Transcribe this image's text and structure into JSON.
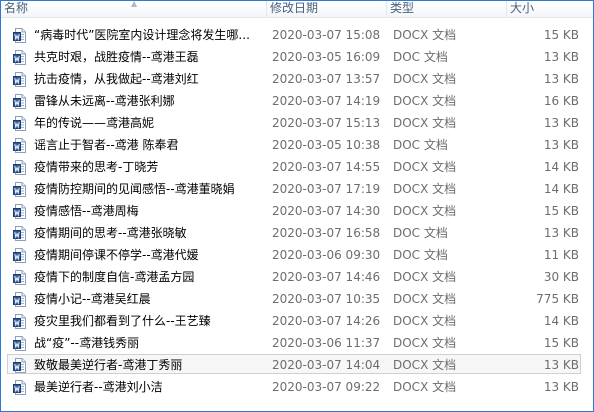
{
  "header": {
    "name": "名称",
    "date": "修改日期",
    "type": "类型",
    "size": "大小"
  },
  "icon": "word-document-icon",
  "files": [
    {
      "name": "“病毒时代”医院室内设计理念将发生哪...",
      "date": "2020-03-07 15:08",
      "type": "DOCX 文档",
      "size": "15 KB"
    },
    {
      "name": "共克时艰，战胜疫情--鸢港王磊",
      "date": "2020-03-05 16:09",
      "type": "DOC 文档",
      "size": "13 KB"
    },
    {
      "name": "抗击疫情，从我做起--鸢港刘红",
      "date": "2020-03-07 13:57",
      "type": "DOCX 文档",
      "size": "13 KB"
    },
    {
      "name": "雷锋从未远离--鸢港张利娜",
      "date": "2020-03-07 14:19",
      "type": "DOCX 文档",
      "size": "16 KB"
    },
    {
      "name": "年的传说——鸢港高妮",
      "date": "2020-03-07 15:13",
      "type": "DOCX 文档",
      "size": "13 KB"
    },
    {
      "name": "谣言止于智者--鸢港 陈奉君",
      "date": "2020-03-05 10:38",
      "type": "DOC 文档",
      "size": "13 KB"
    },
    {
      "name": "疫情带来的思考-丁晓芳",
      "date": "2020-03-07 14:55",
      "type": "DOCX 文档",
      "size": "14 KB"
    },
    {
      "name": "疫情防控期间的见闻感悟--鸢港董晓娟",
      "date": "2020-03-07 17:19",
      "type": "DOCX 文档",
      "size": "14 KB"
    },
    {
      "name": "疫情感悟--鸢港周梅",
      "date": "2020-03-07 14:30",
      "type": "DOCX 文档",
      "size": "15 KB"
    },
    {
      "name": "疫情期间的思考--鸢港张晓敏",
      "date": "2020-03-07 16:58",
      "type": "DOC 文档",
      "size": "13 KB"
    },
    {
      "name": "疫情期间停课不停学--鸢港代媛",
      "date": "2020-03-06 09:30",
      "type": "DOC 文档",
      "size": "11 KB"
    },
    {
      "name": "疫情下的制度自信-鸢港孟方园",
      "date": "2020-03-07 14:46",
      "type": "DOCX 文档",
      "size": "30 KB"
    },
    {
      "name": "疫情小记--鸢港吴红晨",
      "date": "2020-03-07 10:35",
      "type": "DOCX 文档",
      "size": "775 KB"
    },
    {
      "name": "疫灾里我们都看到了什么--王艺臻",
      "date": "2020-03-07 14:26",
      "type": "DOCX 文档",
      "size": "14 KB"
    },
    {
      "name": "战“疫”--鸢港钱秀丽",
      "date": "2020-03-06 11:37",
      "type": "DOCX 文档",
      "size": "15 KB"
    },
    {
      "name": "致敬最美逆行者-鸢港丁秀丽",
      "date": "2020-03-07 14:04",
      "type": "DOCX 文档",
      "size": "13 KB"
    },
    {
      "name": "最美逆行者--鸢港刘小洁",
      "date": "2020-03-07 09:22",
      "type": "DOCX 文档",
      "size": "13 KB"
    }
  ],
  "selected_index": 15
}
